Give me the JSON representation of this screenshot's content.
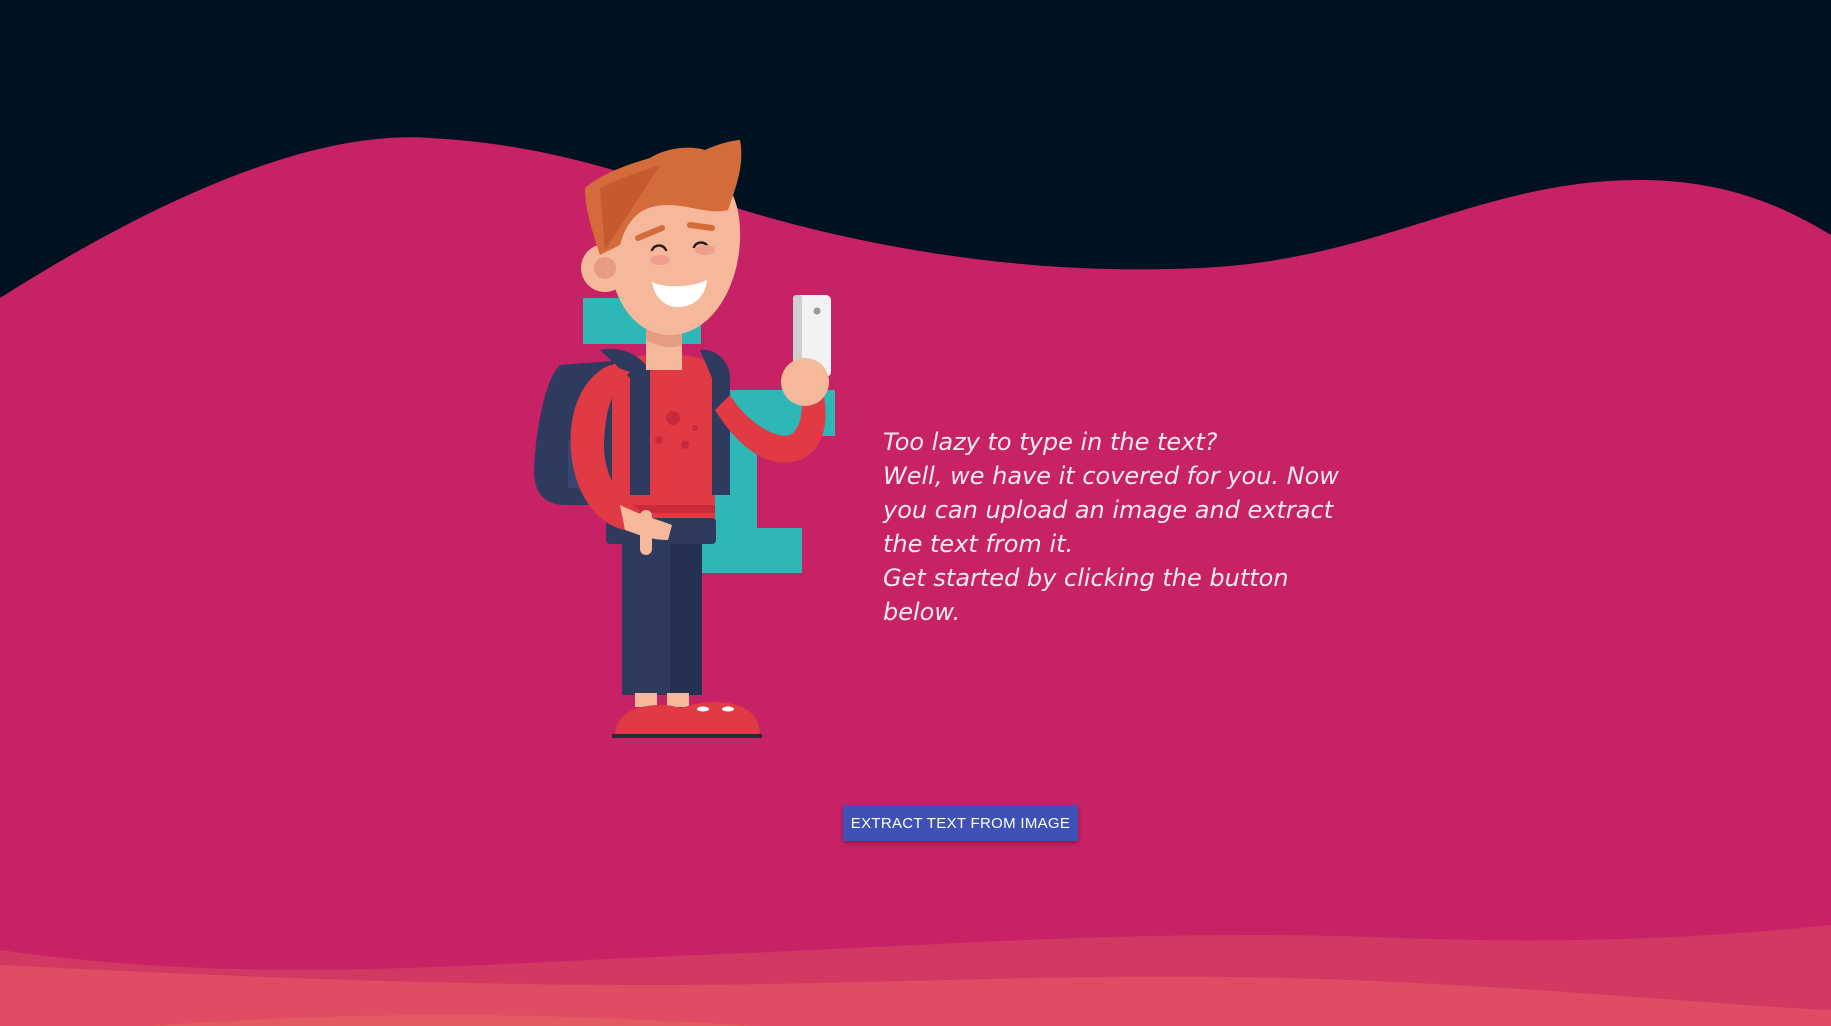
{
  "hero": {
    "tagline_lines": [
      "Too lazy to type in the text?",
      "Well, we have it covered for you. Now you can upload an image and extract the text from it.",
      "Get started by clicking the button below."
    ],
    "button_label": "EXTRACT TEXT FROM IMAGE"
  },
  "colors": {
    "background_top": "#001120",
    "wave_main": "#c72265",
    "wave_bottom_1": "#d23862",
    "wave_bottom_2": "#df4c64",
    "button": "#3f51b5",
    "text": "#f6eaf0"
  },
  "illustration": {
    "icon": "man-with-phone-illustration"
  }
}
